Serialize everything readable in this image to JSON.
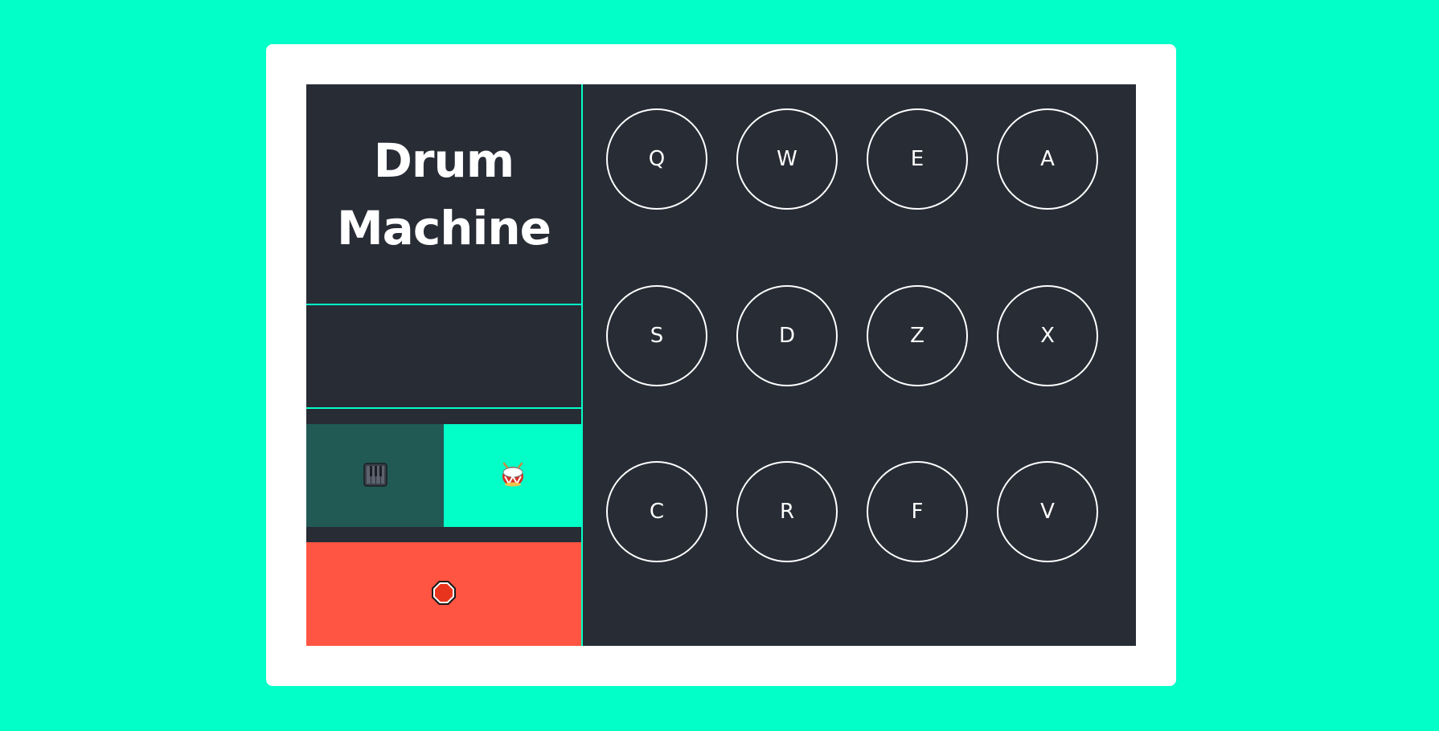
{
  "app": {
    "title": "Drum\nMachine",
    "display_text": ""
  },
  "mode_buttons": {
    "piano": {
      "icon": "piano-keys-icon"
    },
    "drum": {
      "icon": "drum-icon"
    }
  },
  "stop_button": {
    "icon": "stop-sign-icon"
  },
  "pads": [
    {
      "key": "Q"
    },
    {
      "key": "W"
    },
    {
      "key": "E"
    },
    {
      "key": "A"
    },
    {
      "key": "S"
    },
    {
      "key": "D"
    },
    {
      "key": "Z"
    },
    {
      "key": "X"
    },
    {
      "key": "C"
    },
    {
      "key": "R"
    },
    {
      "key": "F"
    },
    {
      "key": "V"
    }
  ],
  "colors": {
    "page_background": "#03ffc8",
    "card_background": "#ffffff",
    "machine_background": "#282c35",
    "divider": "#03ffc8",
    "piano_mode_background": "#215a55",
    "drum_mode_background": "#03ffc8",
    "stop_background": "#ff5542",
    "pad_border": "#ffffff"
  }
}
